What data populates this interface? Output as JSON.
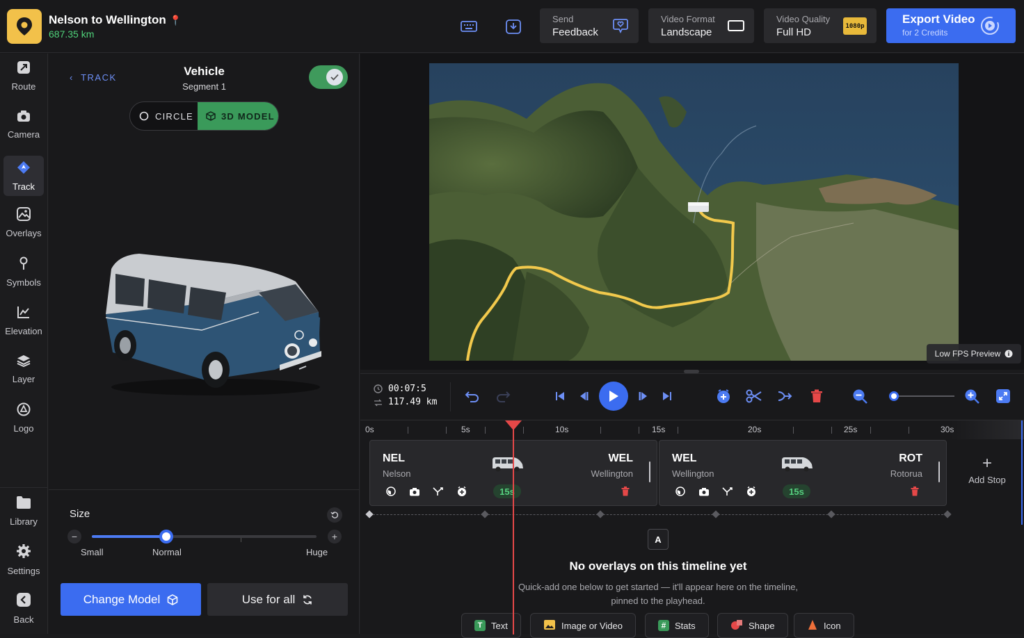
{
  "header": {
    "title": "Nelson to Wellington",
    "distance": "687.35 km",
    "send_feedback": {
      "line1": "Send",
      "line2": "Feedback"
    },
    "video_format": {
      "line1": "Video Format",
      "line2": "Landscape"
    },
    "video_quality": {
      "line1": "Video Quality",
      "line2": "Full HD",
      "badge": "1080p"
    },
    "export": {
      "line1": "Export Video",
      "line2": "for 2 Credits"
    }
  },
  "rail": {
    "items": [
      {
        "label": "Route",
        "icon": "route-icon"
      },
      {
        "label": "Camera",
        "icon": "camera-icon"
      },
      {
        "label": "Track",
        "icon": "track-icon",
        "active": true
      },
      {
        "label": "Overlays",
        "icon": "overlays-icon"
      },
      {
        "label": "Symbols",
        "icon": "symbols-icon"
      },
      {
        "label": "Elevation",
        "icon": "elevation-icon"
      },
      {
        "label": "Layer",
        "icon": "layer-icon"
      },
      {
        "label": "Logo",
        "icon": "logo-icon"
      }
    ],
    "bottom": [
      {
        "label": "Library",
        "icon": "library-icon"
      },
      {
        "label": "Settings",
        "icon": "settings-icon"
      },
      {
        "label": "Back",
        "icon": "back-icon"
      }
    ]
  },
  "panel": {
    "back_label": "TRACK",
    "title": "Vehicle",
    "subtitle": "Segment 1",
    "enabled": true,
    "mode_options": [
      "CIRCLE",
      "3D MODEL"
    ],
    "selected_mode": "3D MODEL",
    "size": {
      "label": "Size",
      "value": 0.33,
      "scale_labels": [
        "Small",
        "Normal",
        "Huge"
      ]
    },
    "change_model": "Change Model",
    "use_for_all": "Use for all"
  },
  "map": {
    "fps_label": "Low FPS Preview",
    "route_color": "#f2c94c"
  },
  "controls": {
    "time": "00:07:5",
    "distance": "117.49 km",
    "zoom_level": 0.05
  },
  "timeline": {
    "ruler": [
      "0s",
      "5s",
      "10s",
      "15s",
      "20s",
      "25s",
      "30s"
    ],
    "playhead_time": "7.5s",
    "segments": [
      {
        "from_code": "NEL",
        "from_city": "Nelson",
        "to_code": "WEL",
        "to_city": "Wellington",
        "duration": "15s"
      },
      {
        "from_code": "WEL",
        "from_city": "Wellington",
        "to_code": "ROT",
        "to_city": "Rotorua",
        "duration": "15s"
      }
    ],
    "add_stop": "Add Stop",
    "overlay_badge": "A",
    "empty_title": "No overlays on this timeline yet",
    "empty_sub": "Quick-add one below to get started — it'll appear here on the timeline, pinned to the playhead.",
    "quick_add": [
      "Text",
      "Image or Video",
      "Stats",
      "Shape",
      "Icon"
    ]
  },
  "colors": {
    "accent": "#3b6cf0",
    "green": "#3f9a5c",
    "danger": "#e54848",
    "logo_bg": "#f2c14a"
  }
}
